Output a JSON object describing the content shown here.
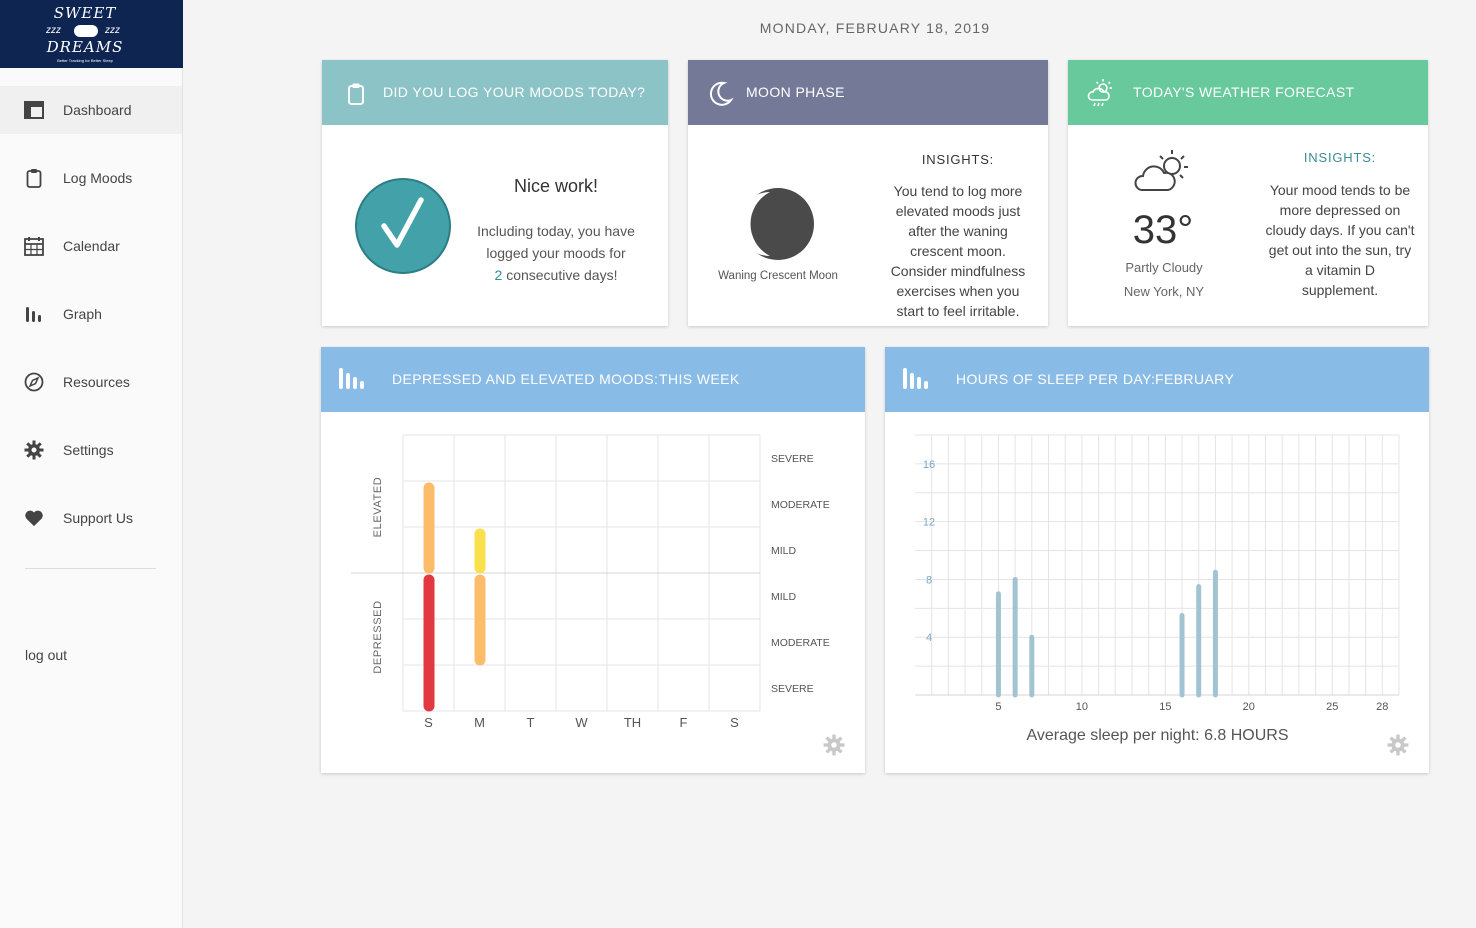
{
  "logo": {
    "line1": "SWEET",
    "line2": "DREAMS",
    "zz_left": "zzz",
    "zz_right": "zzz",
    "tagline": "Better Tracking for Better Sleep"
  },
  "nav": [
    {
      "label": "Dashboard",
      "icon": "dashboard-icon",
      "active": true
    },
    {
      "label": "Log Moods",
      "icon": "clipboard-icon"
    },
    {
      "label": "Calendar",
      "icon": "calendar-icon"
    },
    {
      "label": "Graph",
      "icon": "bar-graph-icon"
    },
    {
      "label": "Resources",
      "icon": "compass-icon"
    },
    {
      "label": "Settings",
      "icon": "gear-icon"
    },
    {
      "label": "Support Us",
      "icon": "heart-icon"
    }
  ],
  "logout": "log out",
  "date": "MONDAY, FEBRUARY 18, 2019",
  "mood_log": {
    "header": "DID YOU LOG YOUR MOODS TODAY?",
    "title": "Nice work!",
    "line1": "Including today, you have logged your moods for",
    "days": "2",
    "line2": " consecutive days!"
  },
  "moon": {
    "header": "MOON PHASE",
    "phase": "Waning Crescent Moon",
    "insights_title": "INSIGHTS:",
    "insights": "You tend to log more elevated moods just after the waning crescent moon. Consider mindfulness exercises when you start to feel irritable."
  },
  "weather": {
    "header": "TODAY'S WEATHER FORECAST",
    "temp": "33°",
    "condition": "Partly Cloudy",
    "city": "New York, NY",
    "insights_title": "INSIGHTS:",
    "insights": "Your mood tends to be more depressed on cloudy days. If you can't get out into the sun, try a vitamin D supplement."
  },
  "mood_chart": {
    "header_a": "DEPRESSED AND ELEVATED MOODS:",
    "header_b": "THIS WEEK",
    "elevated_label": "ELEVATED",
    "depressed_label": "DEPRESSED",
    "levels": [
      "SEVERE",
      "MODERATE",
      "MILD",
      "MILD",
      "MODERATE",
      "SEVERE"
    ],
    "days": [
      "S",
      "M",
      "T",
      "W",
      "TH",
      "F",
      "S"
    ],
    "colors": {
      "mild": "#f9e04c",
      "moderate": "#fcbc6a",
      "severe": "#e2383f"
    }
  },
  "chart_data": {
    "type": "bar",
    "title": "HOURS OF SLEEP PER DAY:",
    "subtitle": "FEBRUARY",
    "x": [
      5,
      6,
      7,
      16,
      17,
      18
    ],
    "values": [
      7,
      8,
      4,
      5.5,
      7.5,
      8.5
    ],
    "x_ticks": [
      5,
      10,
      15,
      20,
      25,
      28
    ],
    "y_ticks": [
      4,
      8,
      12,
      16
    ],
    "xlim": [
      0,
      29
    ],
    "ylim": [
      0,
      18
    ],
    "grid": true,
    "color": "#a2c3d1",
    "footer_label": "Average sleep per night:",
    "footer_value": "6.8 HOURS"
  }
}
